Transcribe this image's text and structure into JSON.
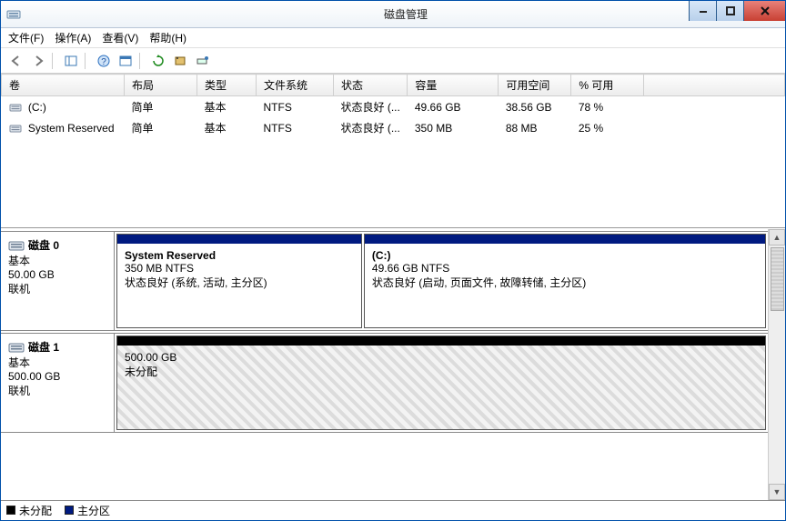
{
  "window": {
    "title": "磁盘管理"
  },
  "menu": {
    "file": "文件(F)",
    "action": "操作(A)",
    "view": "查看(V)",
    "help": "帮助(H)"
  },
  "columns": {
    "vol": "卷",
    "layout": "布局",
    "type": "类型",
    "fs": "文件系统",
    "status": "状态",
    "capacity": "容量",
    "free": "可用空间",
    "pctfree": "% 可用"
  },
  "rows": [
    {
      "vol": " (C:)",
      "layout": "简单",
      "type": "基本",
      "fs": "NTFS",
      "status": "状态良好 (...",
      "capacity": "49.66 GB",
      "free": "38.56 GB",
      "pctfree": "78 %"
    },
    {
      "vol": " System Reserved",
      "layout": "简单",
      "type": "基本",
      "fs": "NTFS",
      "status": "状态良好 (...",
      "capacity": "350 MB",
      "free": "88 MB",
      "pctfree": "25 %"
    }
  ],
  "disks": [
    {
      "name": "磁盘 0",
      "kind": "基本",
      "size": "50.00 GB",
      "state": "联机",
      "parts": [
        {
          "name": "System Reserved",
          "subtitle": "350 MB NTFS",
          "status": "状态良好 (系统, 活动, 主分区)",
          "flex": 28
        },
        {
          "name": " (C:)",
          "subtitle": "49.66 GB NTFS",
          "status": "状态良好 (启动, 页面文件, 故障转储, 主分区)",
          "flex": 46
        }
      ]
    },
    {
      "name": "磁盘 1",
      "kind": "基本",
      "size": "500.00 GB",
      "state": "联机",
      "parts": [
        {
          "name": "",
          "subtitle": "500.00 GB",
          "status": "未分配",
          "flex": 100,
          "unalloc": true
        }
      ]
    }
  ],
  "legend": {
    "unalloc": "未分配",
    "primary": "主分区"
  }
}
